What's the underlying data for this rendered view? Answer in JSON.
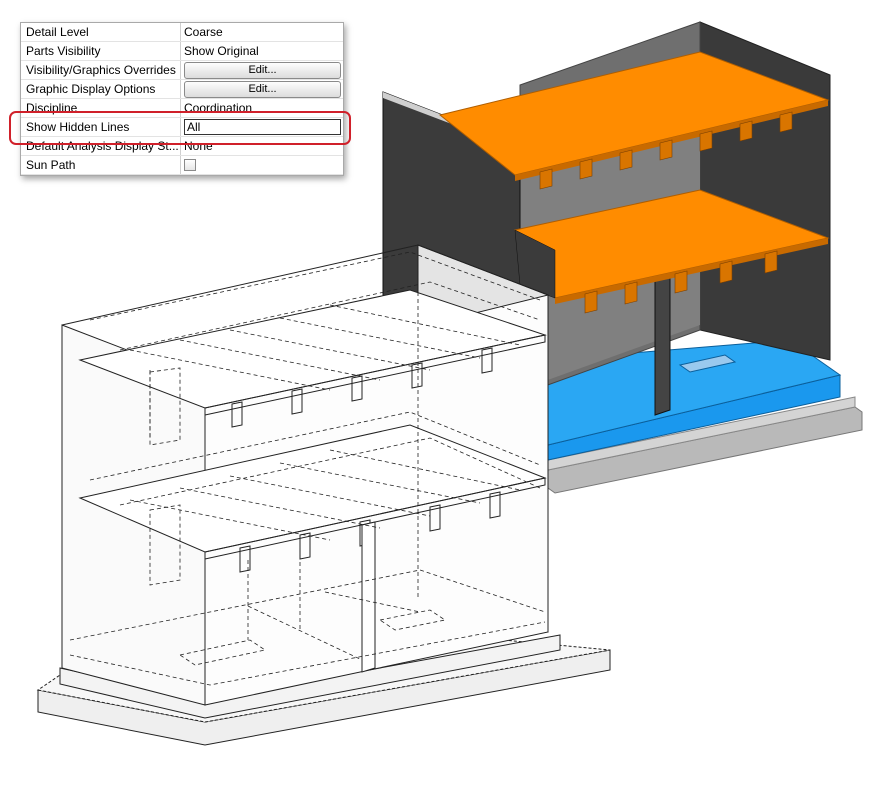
{
  "properties": [
    {
      "label": "Detail Level",
      "value": "Coarse"
    },
    {
      "label": "Parts Visibility",
      "value": "Show Original"
    },
    {
      "label": "Visibility/Graphics Overrides",
      "button": "Edit..."
    },
    {
      "label": "Graphic Display Options",
      "button": "Edit..."
    },
    {
      "label": "Discipline",
      "value": "Coordination"
    },
    {
      "label": "Show Hidden Lines",
      "value": "All"
    },
    {
      "label": "Default Analysis Display St...",
      "value": "None"
    },
    {
      "label": "Sun Path",
      "checked": false
    }
  ],
  "colors": {
    "floor_slab": "#ff8c00",
    "foundation_slab": "#1a98ee",
    "walls": "#3f3f3f",
    "highlight": "#d0202a"
  },
  "views": {
    "shaded": "shaded-3d-view",
    "hidden_lines": "hidden-line-3d-view"
  }
}
